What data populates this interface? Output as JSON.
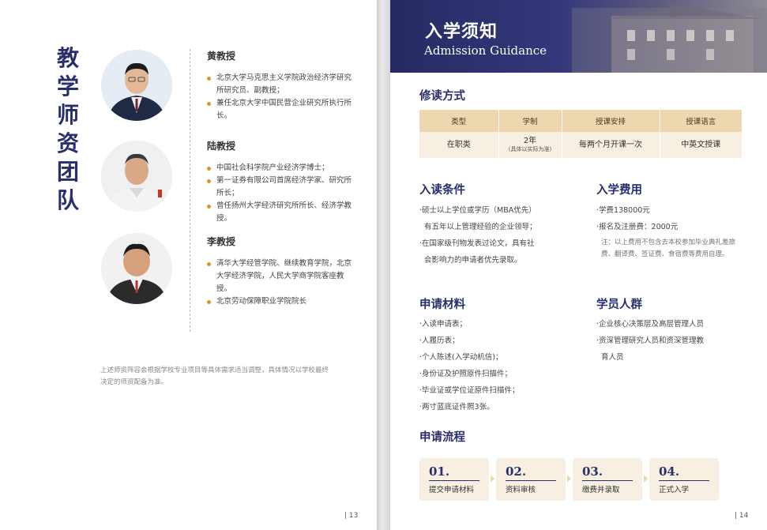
{
  "left_page": {
    "title_chars": [
      "教",
      "学",
      "师",
      "资",
      "团",
      "队"
    ],
    "professors": [
      {
        "name": "黄教授",
        "bullets": [
          "北京大学马克思主义学院政治经济学研究所研究员、副教授；",
          "兼任北京大学中国民营企业研究所执行所长。"
        ]
      },
      {
        "name": "陆教授",
        "bullets": [
          "中国社会科学院产业经济学博士；",
          "第一证券有限公司首席经济学家、研究所所长；",
          "曾任扬州大学经济研究所所长、经济学教授。"
        ]
      },
      {
        "name": "李教授",
        "bullets": [
          "清华大学经管学院、继续教育学院，北京大学经济学院，人民大学商学院客座教授。",
          "北京劳动保障职业学院院长"
        ]
      }
    ],
    "footnote": "上述师资阵容会根据学校专业项目等具体需求适当调整，具体情况以学校最终决定的师资配备为准。",
    "page_number": "| 13"
  },
  "right_page": {
    "banner": {
      "title": "入学须知",
      "subtitle": "Admission Guidance"
    },
    "study_mode": {
      "title": "修读方式",
      "headers": [
        "类型",
        "学制",
        "授课安排",
        "授课语言"
      ],
      "row": {
        "type": "在职类",
        "duration": "2年",
        "duration_note": "(具体以实际为准)",
        "schedule": "每两个月开课一次",
        "language": "中英文授课"
      }
    },
    "admission_conditions": {
      "title": "入读条件",
      "items": [
        "·硕士以上学位或学历（MBA优先）",
        "有五年以上管理经验的企业领导；",
        "·在国家级刊物发表过论文，具有社",
        "会影响力的申请者优先录取。"
      ]
    },
    "fees": {
      "title": "入学费用",
      "items": [
        "·学费138000元",
        "·报名及注册费：2000元"
      ],
      "note": "注：以上费用不包含去本校参加毕业典礼差旅费、翻译费、签证费、食宿费等费用自理。"
    },
    "materials": {
      "title": "申请材料",
      "items": [
        "·入读申请表；",
        "·人履历表；",
        "·个人陈述(入学动机信)；",
        "·身份证及护照原件扫描件；",
        "·毕业证或学位证原件扫描件；",
        "·两寸蓝底证件照3张。"
      ]
    },
    "audience": {
      "title": "学员人群",
      "items": [
        "·企业核心决策层及高层管理人员",
        "·资深管理研究人员和资深管理教",
        "育人员"
      ]
    },
    "process": {
      "title": "申请流程",
      "steps": [
        {
          "num": "01.",
          "label": "提交申请材料"
        },
        {
          "num": "02.",
          "label": "资料审核"
        },
        {
          "num": "03.",
          "label": "缴费并录取"
        },
        {
          "num": "04.",
          "label": "正式入学"
        }
      ]
    },
    "page_number": "| 14"
  },
  "colors": {
    "navy": "#2a2f6b",
    "gold_accent": "#d9952c",
    "table_header": "#ecd7ae",
    "table_cell": "#f7efe1"
  }
}
